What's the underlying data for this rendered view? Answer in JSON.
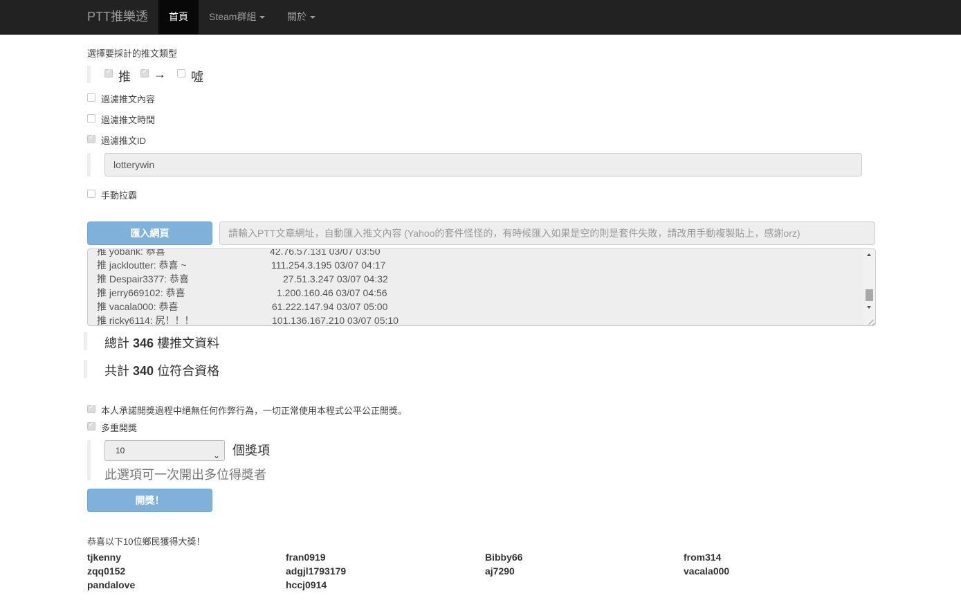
{
  "navbar": {
    "brand": "PTT推樂透",
    "items": [
      {
        "label": "首頁",
        "active": true
      },
      {
        "label": "Steam群組",
        "dropdown": true
      },
      {
        "label": "關於",
        "dropdown": true
      }
    ]
  },
  "push_type": {
    "heading": "選擇要採計的推文類型",
    "options": [
      {
        "label": "推",
        "checked": true
      },
      {
        "label": "→",
        "checked": true
      },
      {
        "label": "噓",
        "checked": false
      }
    ]
  },
  "filters": {
    "content": {
      "label": "過濾推文內容",
      "checked": false
    },
    "time": {
      "label": "過濾推文時間",
      "checked": false
    },
    "id": {
      "label": "過濾推文ID",
      "checked": true,
      "value": "lotterywin"
    },
    "manual": {
      "label": "手動拉霸",
      "checked": false
    }
  },
  "import": {
    "button_label": "匯入網頁",
    "url_placeholder": "請輸入PTT文章網址，自動匯入推文內容 (Yahoo的套件怪怪的，有時候匯入如果是空的則是套件失敗，請改用手動複製貼上，感謝orz)"
  },
  "comments": [
    {
      "text": "推 yobank: 恭喜",
      "meta": "42.76.57.131 03/07 03:50"
    },
    {
      "text": "推 jackloutter: 恭喜 ~",
      "meta": "111.254.3.195 03/07 04:17"
    },
    {
      "text": "推 Despair3377: 恭喜",
      "meta": "27.51.3.247 03/07 04:32"
    },
    {
      "text": "推 jerry669102: 恭喜",
      "meta": "1.200.160.46 03/07 04:56"
    },
    {
      "text": "推 vacala000: 恭喜",
      "meta": "61.222.147.94 03/07 05:00"
    },
    {
      "text": "推 ricky6114: 尻！！！",
      "meta": "101.136.167.210 03/07 05:10"
    }
  ],
  "stats": {
    "total_prefix": "總計",
    "total_count": "346",
    "total_suffix": "樓推文資料",
    "eligible_prefix": "共計",
    "eligible_count": "340",
    "eligible_suffix": "位符合資格"
  },
  "draw": {
    "pledge": {
      "label": "本人承諾開獎過程中絕無任何作弊行為，一切正常使用本程式公平公正開獎。",
      "checked": true
    },
    "multi": {
      "label": "多重開獎",
      "checked": true
    },
    "count_value": "10",
    "count_suffix": "個獎項",
    "hint": "此選項可一次開出多位得獎者",
    "button_label": "開獎！"
  },
  "results": {
    "heading": "恭喜以下10位鄉民獲得大獎！",
    "winners": [
      "tjkenny",
      "fran0919",
      "Bibby66",
      "from314",
      "zqq0152",
      "adgjl1793179",
      "aj7290",
      "vacala000",
      "pandalove",
      "hccj0914"
    ]
  }
}
